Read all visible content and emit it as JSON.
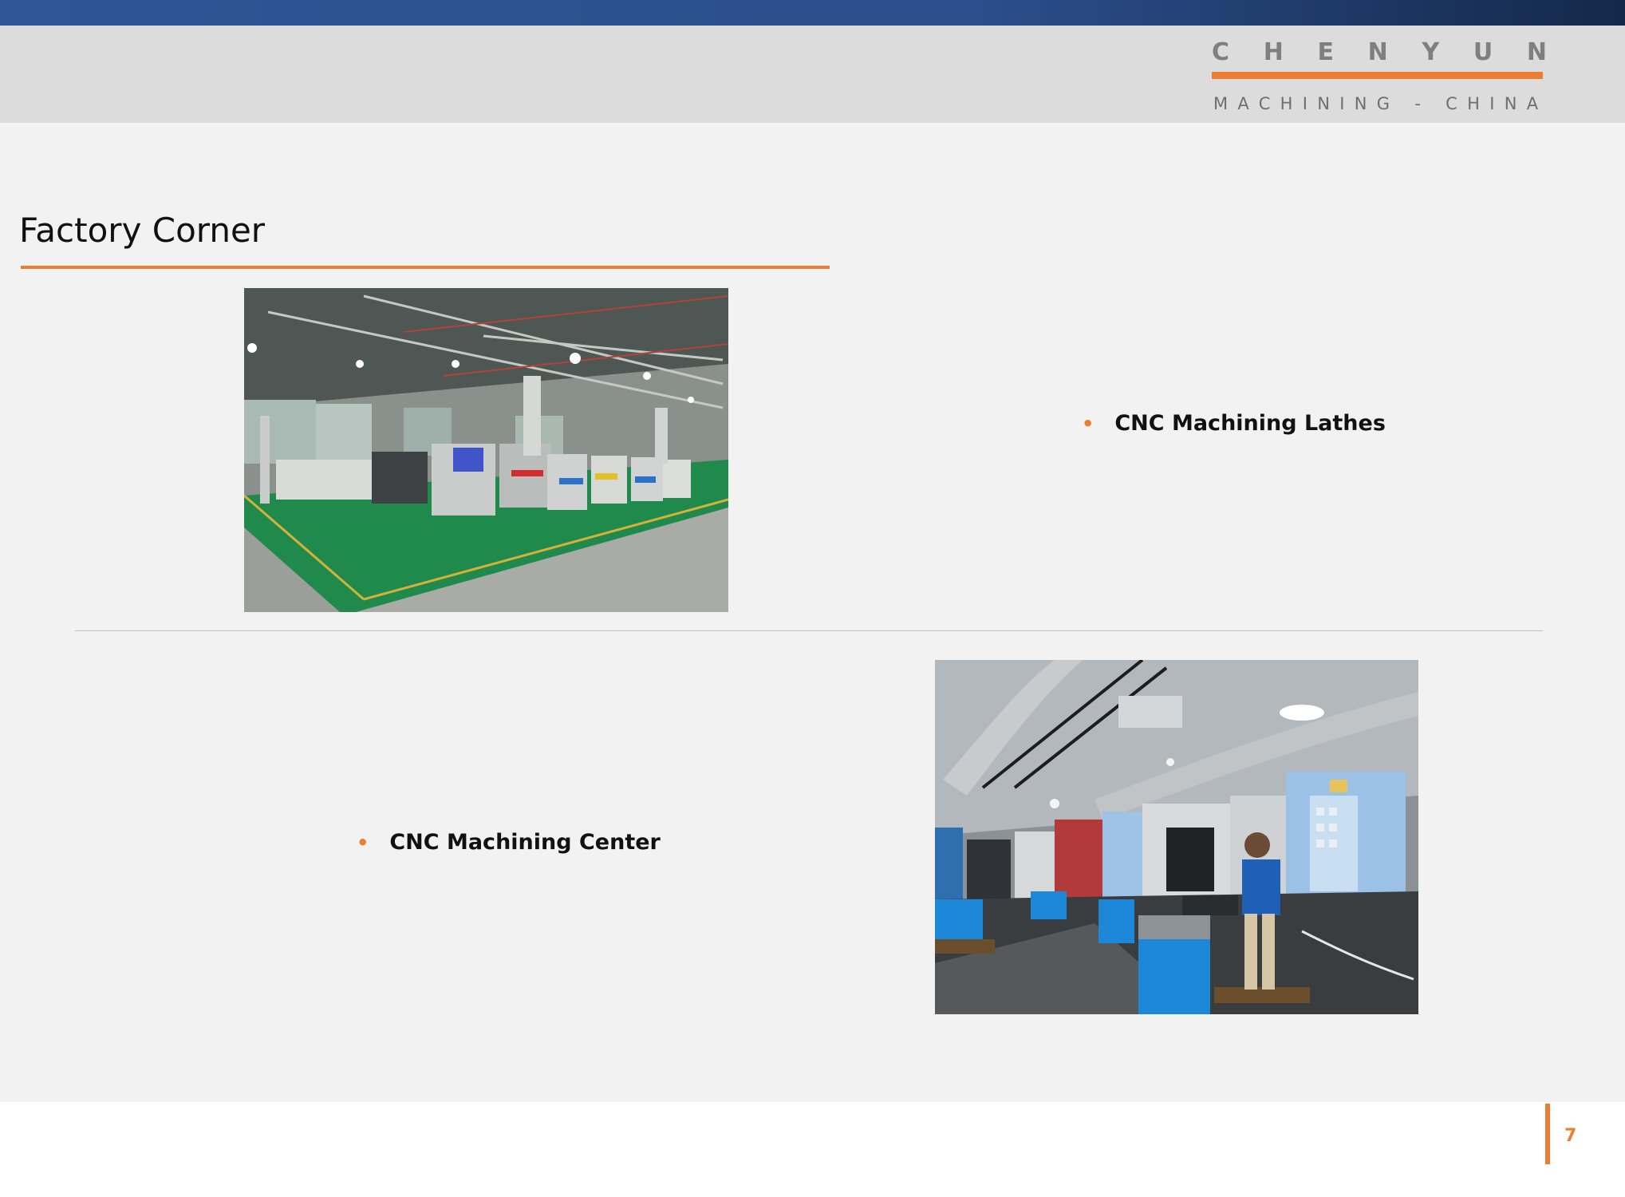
{
  "brand": {
    "name_letters": [
      "C",
      "H",
      "E",
      "N",
      "Y",
      "U",
      "N"
    ],
    "subtitle": "MACHINING - CHINA",
    "accent_color": "#ed7d31",
    "primary_color": "#2f5597"
  },
  "slide": {
    "title": "Factory Corner",
    "bullets": [
      {
        "label": "CNC Machining Lathes"
      },
      {
        "label": "CNC Machining Center"
      }
    ],
    "page_number": "7"
  },
  "photos": [
    {
      "subject": "cnc-lathe-workshop"
    },
    {
      "subject": "cnc-machining-center-workshop"
    }
  ]
}
